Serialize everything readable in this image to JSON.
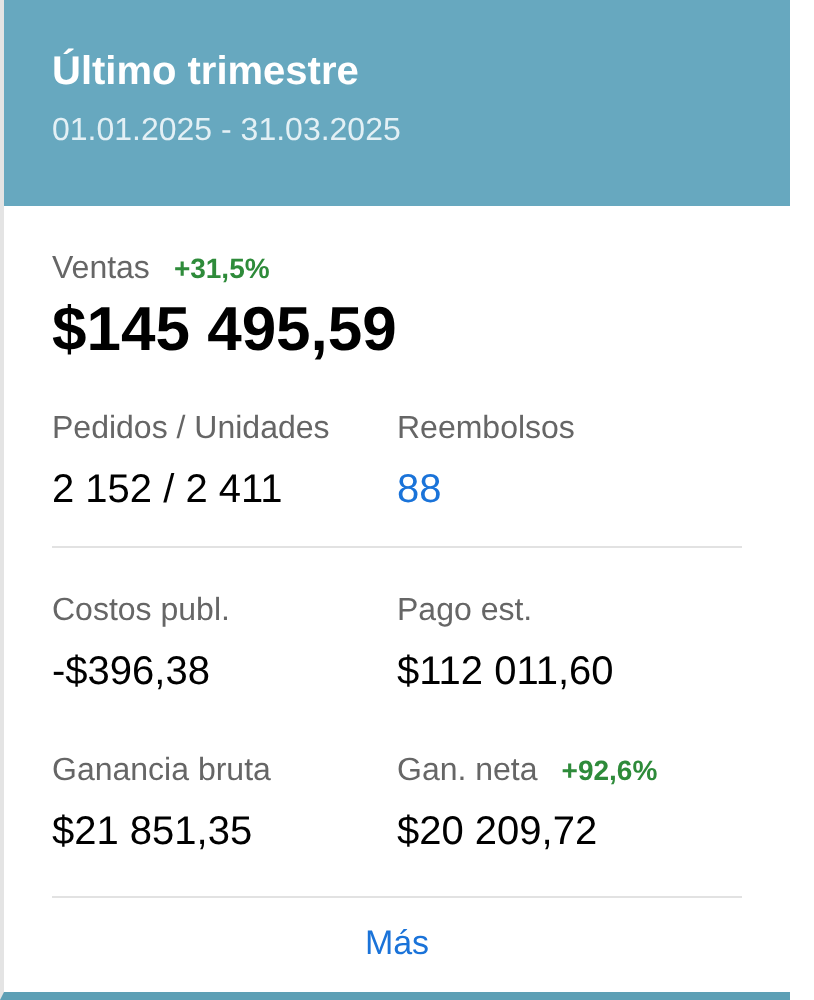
{
  "header": {
    "title": "Último trimestre",
    "date_range": "01.01.2025 - 31.03.2025"
  },
  "sales": {
    "label": "Ventas",
    "change": "+31,5%",
    "value": "$145 495,59"
  },
  "groups": [
    {
      "metrics": [
        {
          "label": "Pedidos / Unidades",
          "value": "2 152 / 2 411",
          "kind": "plain"
        },
        {
          "label": "Reembolsos",
          "value": "88",
          "kind": "link"
        }
      ]
    },
    {
      "metrics": [
        {
          "label": "Costos publ.",
          "value": "-$396,38",
          "kind": "plain"
        },
        {
          "label": "Pago est.",
          "value": "$112 011,60",
          "kind": "plain"
        },
        {
          "label": "Ganancia bruta",
          "value": "$21 851,35",
          "kind": "plain"
        },
        {
          "label": "Gan. neta",
          "change": "+92,6%",
          "value": "$20 209,72",
          "kind": "plain"
        }
      ]
    }
  ],
  "more_link": "Más"
}
